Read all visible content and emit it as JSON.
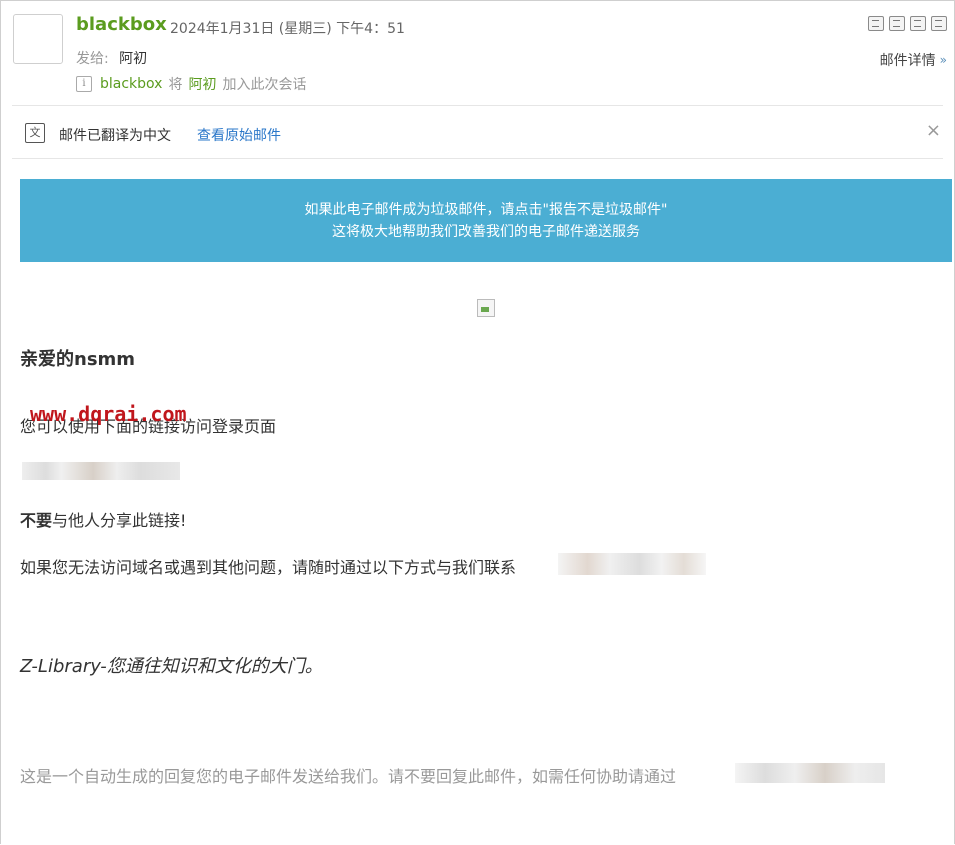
{
  "header": {
    "sender": "blackbox",
    "date": "2024年1月31日 (星期三) 下午4：51",
    "to_label": "发给:",
    "to_name": "阿初",
    "conversation": {
      "from": "blackbox",
      "verb": "将",
      "who": "阿初",
      "action": "加入此次会话"
    },
    "details_label": "邮件详情",
    "details_chevron": "»"
  },
  "translate_bar": {
    "icon_text": "文",
    "status": "邮件已翻译为中文",
    "view_original": "查看原始邮件",
    "close": "×"
  },
  "banner": {
    "line1": "如果此电子邮件成为垃圾邮件，请点击\"报告不是垃圾邮件\"",
    "line2": "这将极大地帮助我们改善我们的电子邮件递送服务"
  },
  "body": {
    "greeting": "亲爱的nsmm",
    "watermark": "www.dqrai.com",
    "para1": "您可以使用下面的链接访问登录页面",
    "para2_bold": "不要",
    "para2_rest": "与他人分享此链接!",
    "para3": "如果您无法访问域名或遇到其他问题，请随时通过以下方式与我们联系",
    "tagline": "Z-Library-您通往知识和文化的大门。",
    "footer": "这是一个自动生成的回复您的电子邮件发送给我们。请不要回复此邮件，如需任何协助请通过"
  },
  "colors": {
    "sender_green": "#5b9c1f",
    "link_blue": "#2a77c9",
    "banner_bg": "#4baed3",
    "watermark_red": "#c0161c"
  },
  "icons": [
    "popout-icon",
    "print-preview-icon",
    "download-icon",
    "print-icon",
    "info-icon",
    "translate-icon",
    "close-icon"
  ]
}
